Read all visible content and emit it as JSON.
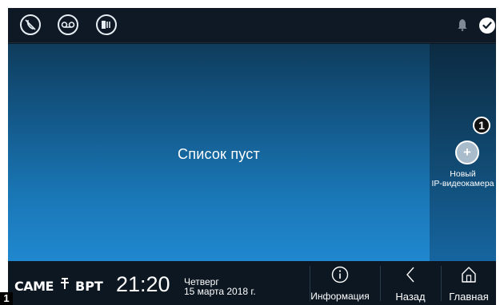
{
  "topbar": {
    "icons": [
      "mute-call-icon",
      "voicemail-icon",
      "door-sensor-icon"
    ],
    "right_icons": [
      "bell-icon",
      "check-icon"
    ]
  },
  "main": {
    "empty_text": "Список пуст"
  },
  "side": {
    "add_symbol": "+",
    "add_label_line1": "Новый",
    "add_label_line2": "IP-видеокамера",
    "marker": "1"
  },
  "bottombar": {
    "brand_came": "CAME",
    "brand_sep": "ᐩ",
    "brand_bpt": "BPT",
    "time": "21:20",
    "day": "Четверг",
    "date": "15 марта 2018 г.",
    "nav": {
      "info": "Информация",
      "back": "Назад",
      "home": "Главная"
    }
  },
  "page_number": "1",
  "colors": {
    "background": "#0d1822",
    "main_gradient_top": "#0f3c5c",
    "main_gradient_bottom": "#2088cf",
    "side_panel": "#114a72",
    "text": "#ffffff"
  }
}
